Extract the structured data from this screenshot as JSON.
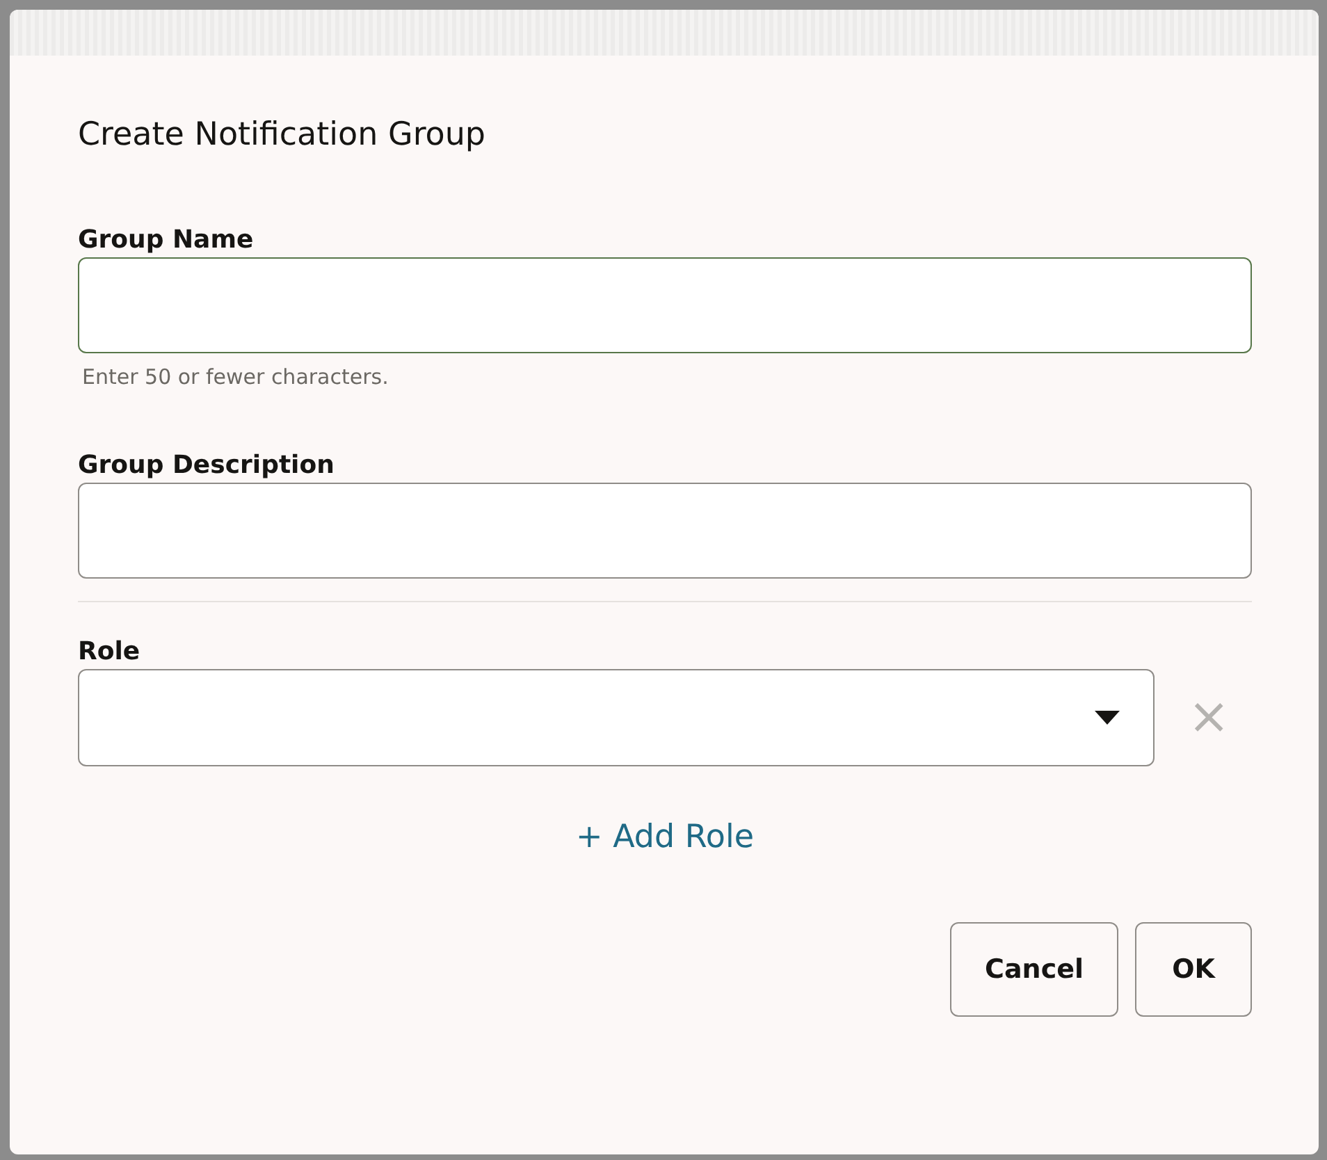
{
  "dialog": {
    "title": "Create Notification Group"
  },
  "fields": [
    {
      "label": "Group Name",
      "hint": "Enter 50 or fewer characters.",
      "focused": true
    },
    {
      "label": "Group Description",
      "focused": false
    }
  ],
  "role": {
    "label": "Role",
    "remove_icon": "×"
  },
  "add_role": "+ Add Role",
  "buttons": [
    {
      "label": "Cancel"
    },
    {
      "label": "OK"
    }
  ]
}
